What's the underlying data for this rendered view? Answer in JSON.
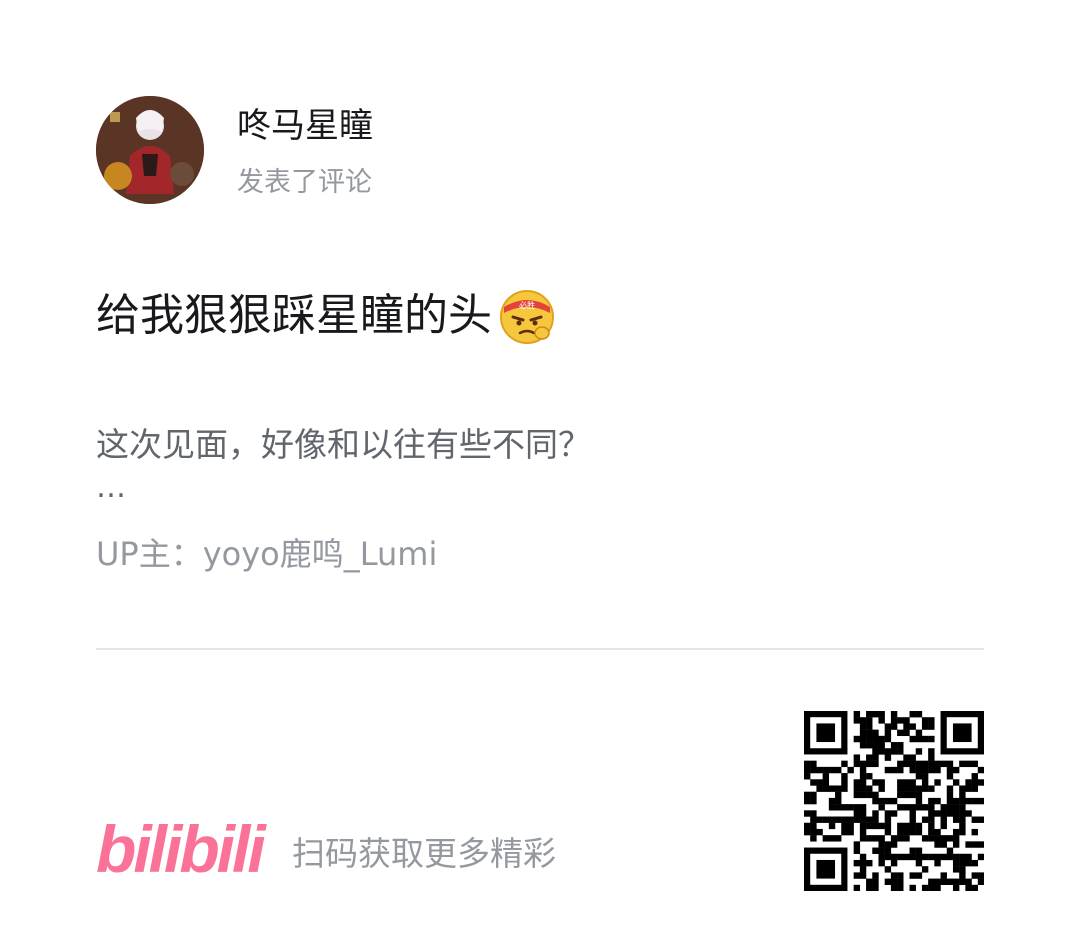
{
  "user": {
    "name": "咚马星瞳",
    "action": "发表了评论"
  },
  "comment": {
    "text": "给我狠狠踩星瞳的头",
    "emoji": "angry-headband-emoji",
    "emoji_badge": "必胜"
  },
  "video": {
    "title": "这次见面，好像和以往有些不同？",
    "ellipsis": "…",
    "up_line": "UP主：yoyo鹿鸣_Lumi"
  },
  "footer": {
    "logo_text": "bilibili",
    "scan_text": "扫码获取更多精彩",
    "qr_icon": "qr-code-icon"
  },
  "colors": {
    "brand_pink": "#fb7299",
    "text_primary": "#18191c",
    "text_secondary": "#61666d",
    "text_tertiary": "#9499a0",
    "divider": "#e3e5e7"
  }
}
